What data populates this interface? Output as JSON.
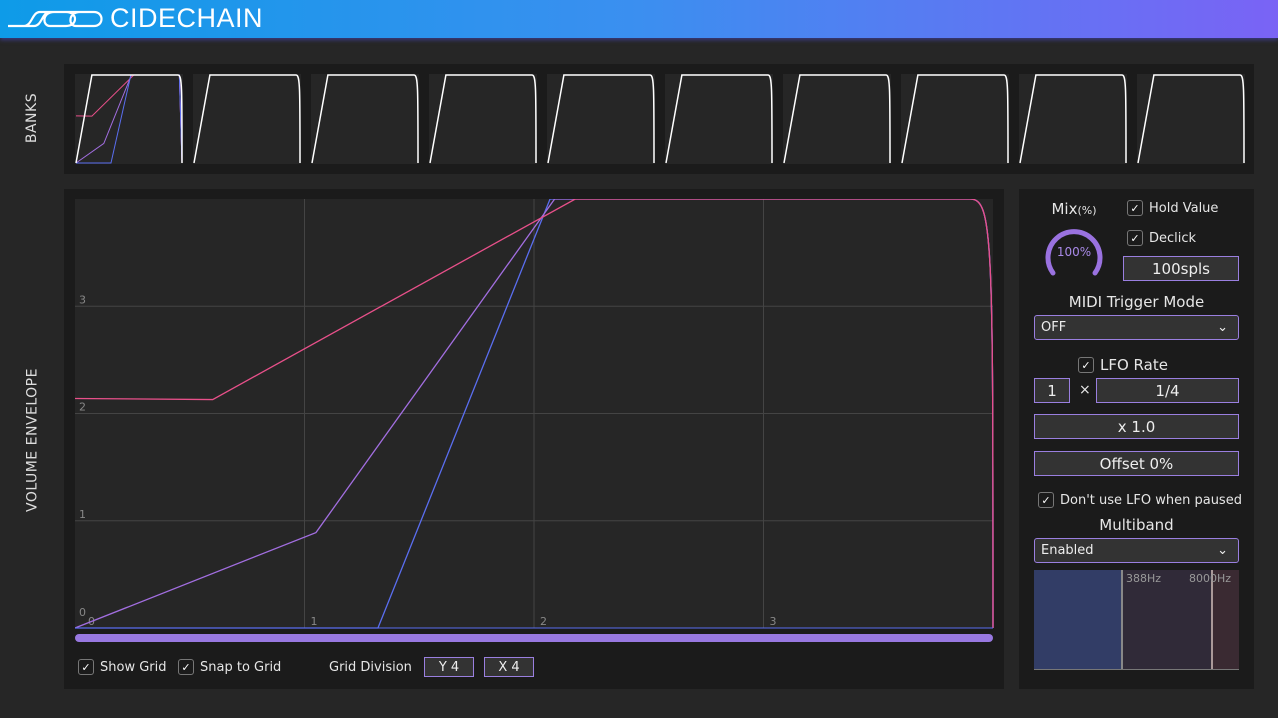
{
  "header": {
    "title": "CIDECHAIN",
    "gradient": [
      "#0e9be8",
      "#7a63f5"
    ]
  },
  "banks": {
    "label": "BANKS",
    "count": 10,
    "selected": 0
  },
  "envelope": {
    "label": "VOLUME ENVELOPE",
    "x_ticks": [
      "0",
      "1",
      "2",
      "3"
    ],
    "y_ticks": [
      "0",
      "1",
      "2",
      "3"
    ],
    "xlim": [
      0,
      4
    ],
    "ylim": [
      0,
      4
    ],
    "curves": [
      {
        "color": "#e8508a",
        "points": [
          [
            0,
            2.14
          ],
          [
            0.6,
            2.13
          ],
          [
            2.18,
            4
          ],
          [
            3.9,
            4
          ],
          [
            4,
            0
          ]
        ]
      },
      {
        "color": "#a26ee0",
        "points": [
          [
            0,
            0
          ],
          [
            1.05,
            0.89
          ],
          [
            2.09,
            4
          ],
          [
            3.9,
            4
          ],
          [
            4,
            0
          ]
        ]
      },
      {
        "color": "#5a6ef0",
        "points": [
          [
            0,
            0
          ],
          [
            1.32,
            0
          ],
          [
            2.07,
            4
          ],
          [
            3.9,
            4
          ],
          [
            4,
            0
          ]
        ]
      }
    ],
    "scrollbar_color": "#9878e0",
    "show_grid": {
      "label": "Show Grid",
      "checked": true
    },
    "snap_to_grid": {
      "label": "Snap to Grid",
      "checked": true
    },
    "grid_division": {
      "label": "Grid Division",
      "y": "Y 4",
      "x": "X 4"
    }
  },
  "settings": {
    "mix": {
      "label": "Mix",
      "unit": "(%)",
      "value": "100%",
      "percent": 100
    },
    "hold_value": {
      "label": "Hold Value",
      "checked": true
    },
    "declick": {
      "label": "Declick",
      "checked": true,
      "value": "100spls"
    },
    "midi_trigger": {
      "label": "MIDI Trigger Mode",
      "value": "OFF"
    },
    "lfo_rate": {
      "label": "LFO Rate",
      "checked": true,
      "multiplier": "1",
      "times": "×",
      "division": "1/4",
      "scale": "x 1.0",
      "offset": "Offset 0%"
    },
    "lfo_paused": {
      "label": "Don't use LFO when paused",
      "checked": true
    },
    "multiband": {
      "label": "Multiband",
      "value": "Enabled",
      "low_freq": "388Hz",
      "high_freq": "8000Hz",
      "band_colors": [
        "#323d66",
        "#302a38",
        "#3a2a32"
      ]
    }
  }
}
